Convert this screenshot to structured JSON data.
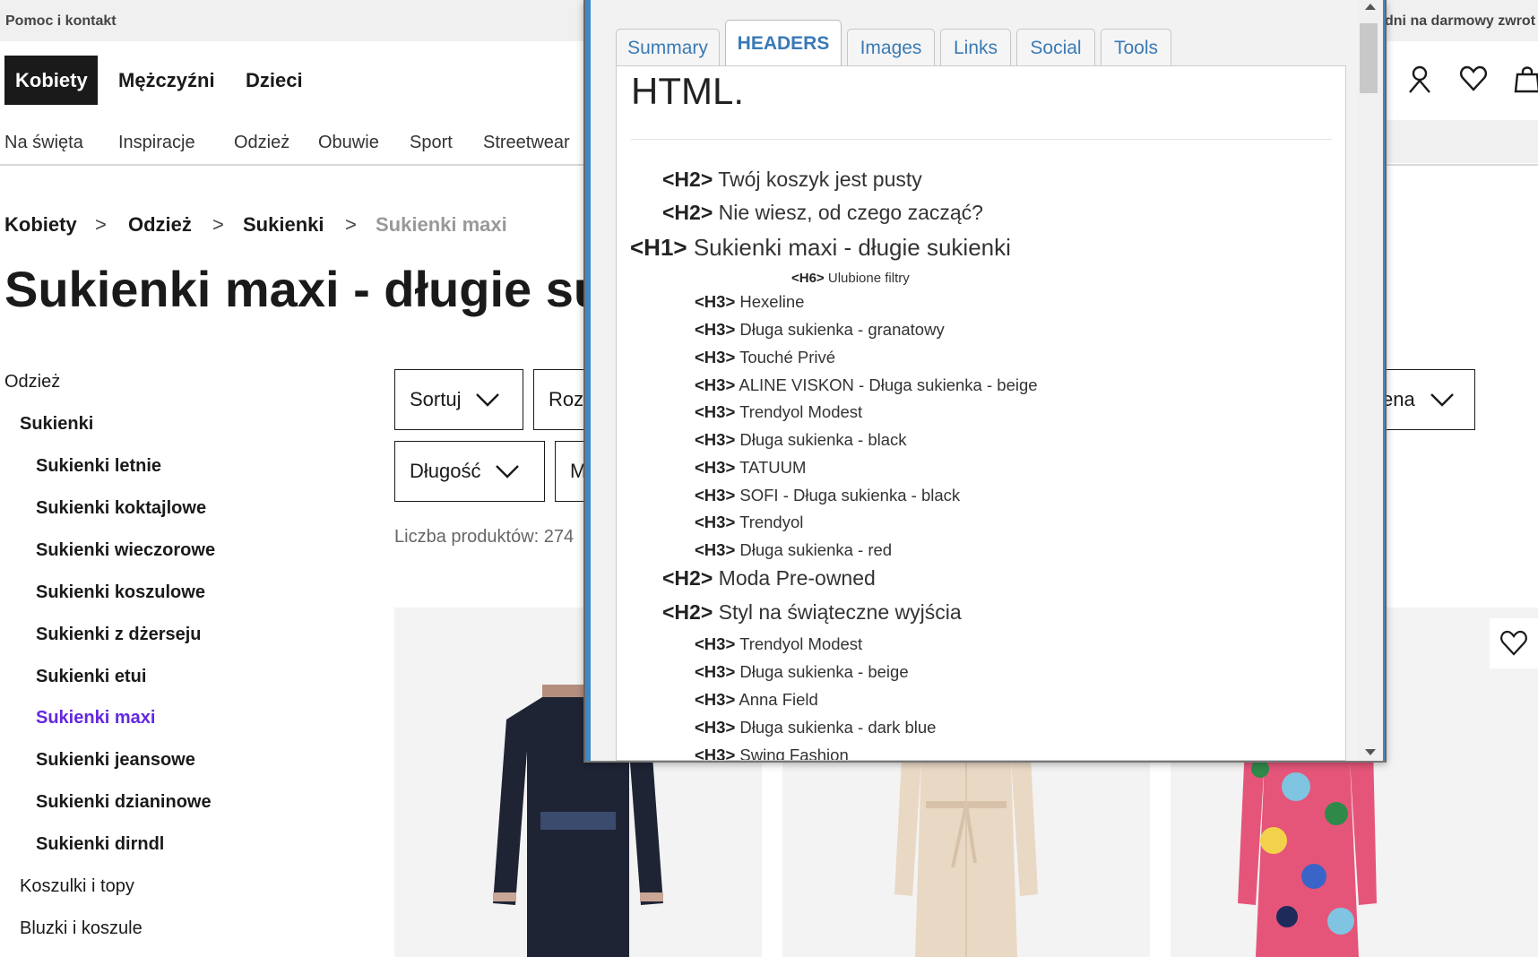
{
  "topbar": {
    "help": "Pomoc i kontakt",
    "promo": "dni na darmowy zwrot"
  },
  "gender_tabs": [
    "Kobiety",
    "Mężczyźni",
    "Dzieci"
  ],
  "category_nav": [
    "Na święta",
    "Inspiracje",
    "Odzież",
    "Obuwie",
    "Sport",
    "Streetwear"
  ],
  "breadcrumbs": [
    "Kobiety",
    "Odzież",
    "Sukienki",
    "Sukienki maxi"
  ],
  "breadcrumb_separator": ">",
  "page_title": "Sukienki maxi - długie sukienki",
  "sidebar": [
    {
      "label": "Odzież",
      "level": 0
    },
    {
      "label": "Sukienki",
      "level": 1
    },
    {
      "label": "Sukienki letnie",
      "level": 2
    },
    {
      "label": "Sukienki koktajlowe",
      "level": 2
    },
    {
      "label": "Sukienki wieczorowe",
      "level": 2
    },
    {
      "label": "Sukienki koszulowe",
      "level": 2
    },
    {
      "label": "Sukienki z dżerseju",
      "level": 2
    },
    {
      "label": "Sukienki etui",
      "level": 2
    },
    {
      "label": "Sukienki maxi",
      "level": 2,
      "active": true
    },
    {
      "label": "Sukienki jeansowe",
      "level": 2
    },
    {
      "label": "Sukienki dzianinowe",
      "level": 2
    },
    {
      "label": "Sukienki dirndl",
      "level": 2
    },
    {
      "label": "Koszulki i topy",
      "level": 1
    },
    {
      "label": "Bluzki i koszule",
      "level": 1
    }
  ],
  "filters": {
    "sort": "Sortuj",
    "size_partial": "Roz",
    "price_partial": "ena",
    "length": "Długość",
    "other_partial": "M"
  },
  "product_count": "Liczba produktów: 274",
  "colors": {
    "accent_purple": "#6328e0",
    "popup_tab_blue": "#3a7ab5",
    "popup_frame": "#3f88c5"
  },
  "popup": {
    "tabs": [
      "Summary",
      "HEADERS",
      "Images",
      "Links",
      "Social",
      "Tools"
    ],
    "active_tab": "HEADERS",
    "lead_text": "HTML.",
    "headers": [
      {
        "tag": "<H2>",
        "text": "Twój koszyk jest pusty",
        "level": 2
      },
      {
        "tag": "<H2>",
        "text": "Nie wiesz, od czego zacząć?",
        "level": 2
      },
      {
        "tag": "<H1>",
        "text": "Sukienki maxi - długie sukienki",
        "level": 1
      },
      {
        "tag": "<H6>",
        "text": "Ulubione filtry",
        "level": 6
      },
      {
        "tag": "<H3>",
        "text": "Hexeline",
        "level": 3
      },
      {
        "tag": "<H3>",
        "text": "Długa sukienka - granatowy",
        "level": 3
      },
      {
        "tag": "<H3>",
        "text": "Touché Privé",
        "level": 3
      },
      {
        "tag": "<H3>",
        "text": "ALINE VISKON - Długa sukienka - beige",
        "level": 3
      },
      {
        "tag": "<H3>",
        "text": "Trendyol Modest",
        "level": 3
      },
      {
        "tag": "<H3>",
        "text": "Długa sukienka - black",
        "level": 3
      },
      {
        "tag": "<H3>",
        "text": "TATUUM",
        "level": 3
      },
      {
        "tag": "<H3>",
        "text": "SOFI - Długa sukienka - black",
        "level": 3
      },
      {
        "tag": "<H3>",
        "text": "Trendyol",
        "level": 3
      },
      {
        "tag": "<H3>",
        "text": "Długa sukienka - red",
        "level": 3
      },
      {
        "tag": "<H2>",
        "text": "Moda Pre-owned",
        "level": 2
      },
      {
        "tag": "<H2>",
        "text": "Styl na świąteczne wyjścia",
        "level": 2
      },
      {
        "tag": "<H3>",
        "text": "Trendyol Modest",
        "level": 3
      },
      {
        "tag": "<H3>",
        "text": "Długa sukienka - beige",
        "level": 3
      },
      {
        "tag": "<H3>",
        "text": "Anna Field",
        "level": 3
      },
      {
        "tag": "<H3>",
        "text": "Długa sukienka - dark blue",
        "level": 3
      },
      {
        "tag": "<H3>",
        "text": "Swing Fashion",
        "level": 3
      }
    ]
  }
}
